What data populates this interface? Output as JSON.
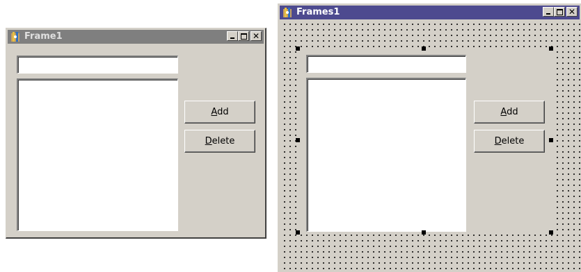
{
  "frame1": {
    "title": "Frame1",
    "edit_value": "",
    "add_button": {
      "accel": "A",
      "rest": "dd"
    },
    "delete_button": {
      "accel": "D",
      "rest": "elete"
    },
    "listbox_items": []
  },
  "frames1": {
    "title": "Frames1",
    "edit_value": "",
    "add_button": {
      "accel": "A",
      "rest": "dd"
    },
    "delete_button": {
      "accel": "D",
      "rest": "elete"
    },
    "listbox_items": []
  },
  "caption_buttons": [
    "minimize-icon",
    "maximize-icon",
    "close-icon"
  ],
  "colors": {
    "active_title": "#4d4a8f",
    "inactive_title": "#7f7f7f",
    "face": "#d4d0c8"
  }
}
